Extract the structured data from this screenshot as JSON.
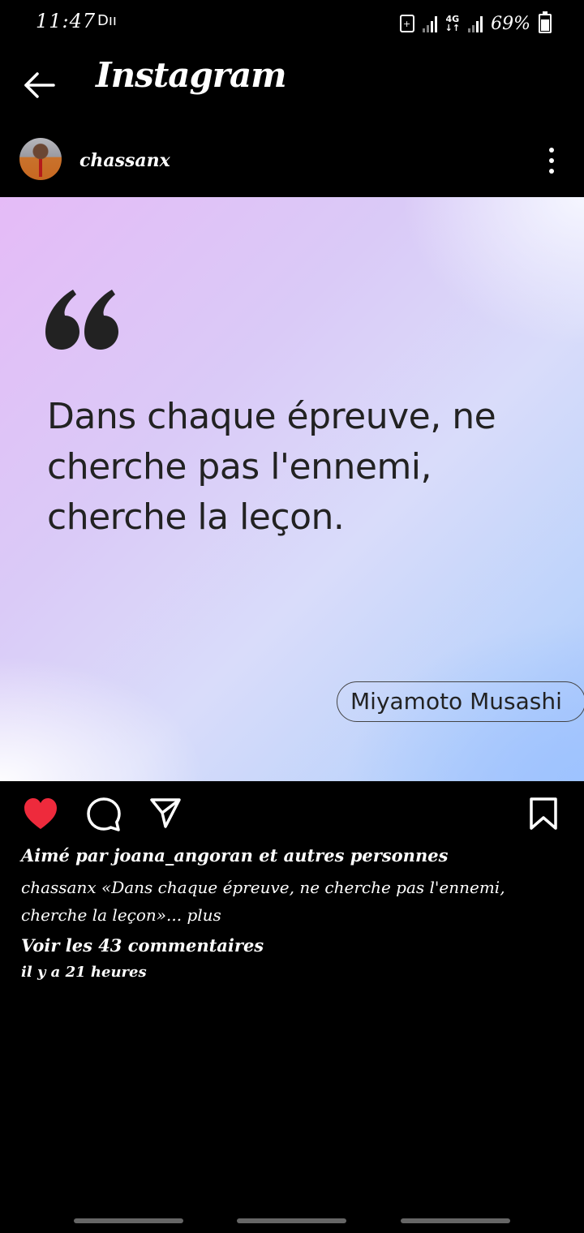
{
  "status_bar": {
    "time": "11:47",
    "extra": "Dıı",
    "network_type": "4G",
    "battery": "69%"
  },
  "header": {
    "title": "Instagram"
  },
  "post": {
    "username": "chassanx",
    "quote_lines": [
      "Dans chaque épreuve, ne",
      "cherche pas l'ennemi,",
      "cherche la leçon."
    ],
    "author": "Miyamoto Musashi",
    "likes_text": "Aimé par joana_angoran et autres personnes",
    "caption_user": "chassanx",
    "caption_text": "«Dans chaque épreuve, ne cherche pas l'ennemi, cherche la leçon»... plus",
    "view_comments": "Voir les 43 commentaires",
    "time_ago": "il y a 21 heures"
  },
  "colors": {
    "like_red": "#ee2a3c",
    "background": "#000000"
  }
}
